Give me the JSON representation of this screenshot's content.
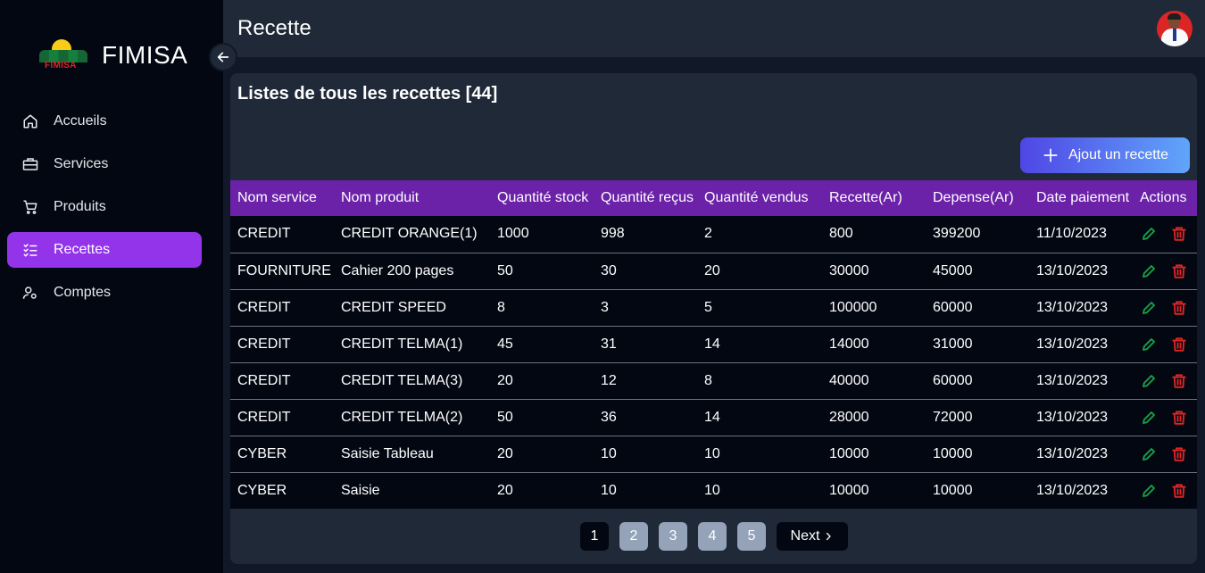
{
  "brand": {
    "name": "FIMISA",
    "logo_text": "FIMISA"
  },
  "sidebar": {
    "items": [
      {
        "label": "Accueils",
        "icon": "home-icon"
      },
      {
        "label": "Services",
        "icon": "briefcase-icon"
      },
      {
        "label": "Produits",
        "icon": "cart-icon"
      },
      {
        "label": "Recettes",
        "icon": "checklist-icon",
        "active": true
      },
      {
        "label": "Comptes",
        "icon": "user-settings-icon"
      }
    ]
  },
  "header": {
    "title": "Recette"
  },
  "card": {
    "title": "Listes de tous les recettes [44]",
    "add_label": "Ajout un recette"
  },
  "table": {
    "headers": [
      "Nom service",
      "Nom produit",
      "Quantité stock",
      "Quantité reçus",
      "Quantité vendus",
      "Recette(Ar)",
      "Depense(Ar)",
      "Date paiement",
      "Actions"
    ],
    "rows": [
      [
        "CREDIT",
        "CREDIT ORANGE(1)",
        "1000",
        "998",
        "2",
        "800",
        "399200",
        "11/10/2023"
      ],
      [
        "FOURNITURE",
        "Cahier 200 pages",
        "50",
        "30",
        "20",
        "30000",
        "45000",
        "13/10/2023"
      ],
      [
        "CREDIT",
        "CREDIT SPEED",
        "8",
        "3",
        "5",
        "100000",
        "60000",
        "13/10/2023"
      ],
      [
        "CREDIT",
        "CREDIT TELMA(1)",
        "45",
        "31",
        "14",
        "14000",
        "31000",
        "13/10/2023"
      ],
      [
        "CREDIT",
        "CREDIT TELMA(3)",
        "20",
        "12",
        "8",
        "40000",
        "60000",
        "13/10/2023"
      ],
      [
        "CREDIT",
        "CREDIT TELMA(2)",
        "50",
        "36",
        "14",
        "28000",
        "72000",
        "13/10/2023"
      ],
      [
        "CYBER",
        "Saisie Tableau",
        "20",
        "10",
        "10",
        "10000",
        "10000",
        "13/10/2023"
      ],
      [
        "CYBER",
        "Saisie",
        "20",
        "10",
        "10",
        "10000",
        "10000",
        "13/10/2023"
      ]
    ]
  },
  "pagination": {
    "pages": [
      "1",
      "2",
      "3",
      "4",
      "5"
    ],
    "current": "1",
    "next_label": "Next"
  },
  "colors": {
    "accent": "#9333ea",
    "table_header": "#6b21a8",
    "edit": "#16a34a",
    "delete": "#dc2626"
  }
}
